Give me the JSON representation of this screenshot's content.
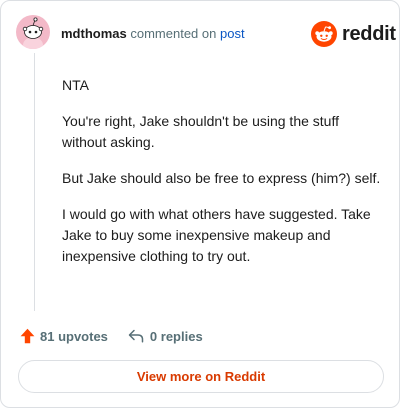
{
  "header": {
    "username": "mdthomas",
    "action_text": "commented on",
    "post_link_text": "post",
    "avatar_icon": "reddit-snoo-avatar-icon"
  },
  "brand": {
    "logo_text": "reddit",
    "logo_icon": "reddit-alien-icon",
    "accent_color": "#ff4500"
  },
  "comment": {
    "paragraphs": [
      "NTA",
      "You're right, Jake shouldn't be using the stuff without asking.",
      "But Jake should also be free to express (him?) self.",
      "I would go with what others have suggested. Take Jake to buy some inexpensive makeup and inexpensive clothing to try out."
    ]
  },
  "actions": {
    "upvotes_label": "81 upvotes",
    "replies_label": "0 replies",
    "upvote_icon": "upvote-arrow-icon",
    "reply_icon": "reply-icon"
  },
  "footer": {
    "view_more_label": "View more on Reddit"
  }
}
